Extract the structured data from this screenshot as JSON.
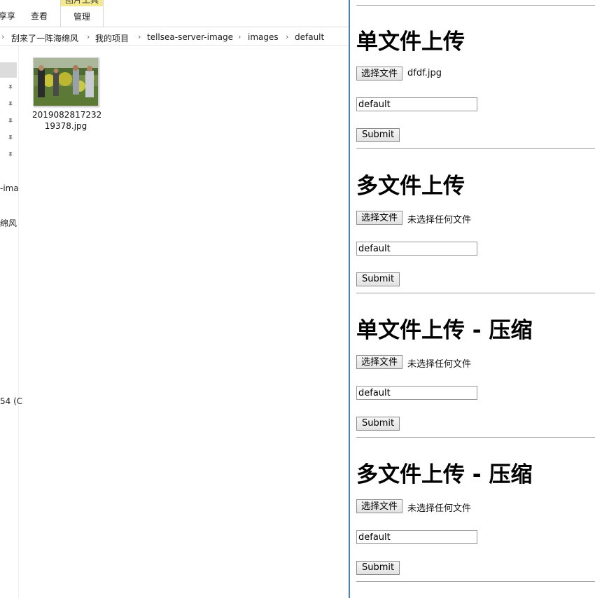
{
  "explorer": {
    "ribbon": {
      "tab_share": "享享",
      "tab_view": "查看",
      "context_group": "图片工具",
      "tab_manage": "管理"
    },
    "breadcrumb": [
      "刮来了一阵海绵风",
      "我的项目",
      "tellsea-server-image",
      "images",
      "default"
    ],
    "nav_fragments": {
      "item1": "-ima",
      "item2": "绵风",
      "item3": "54 (C"
    },
    "file": {
      "name_line1": "2019082817232",
      "name_line2": "19378.jpg"
    }
  },
  "page": {
    "sections": [
      {
        "title": "单文件上传",
        "choose_label": "选择文件",
        "file_status": "dfdf.jpg",
        "input_value": "default",
        "submit_label": "Submit"
      },
      {
        "title": "多文件上传",
        "choose_label": "选择文件",
        "file_status": "未选择任何文件",
        "input_value": "default",
        "submit_label": "Submit"
      },
      {
        "title": "单文件上传 - 压缩",
        "choose_label": "选择文件",
        "file_status": "未选择任何文件",
        "input_value": "default",
        "submit_label": "Submit"
      },
      {
        "title": "多文件上传 - 压缩",
        "choose_label": "选择文件",
        "file_status": "未选择任何文件",
        "input_value": "default",
        "submit_label": "Submit"
      }
    ]
  },
  "colors": {
    "context_tab_highlight": "#f4e98c",
    "window_border": "#4a7fb5",
    "nav_selected": "#dcdcdc"
  }
}
